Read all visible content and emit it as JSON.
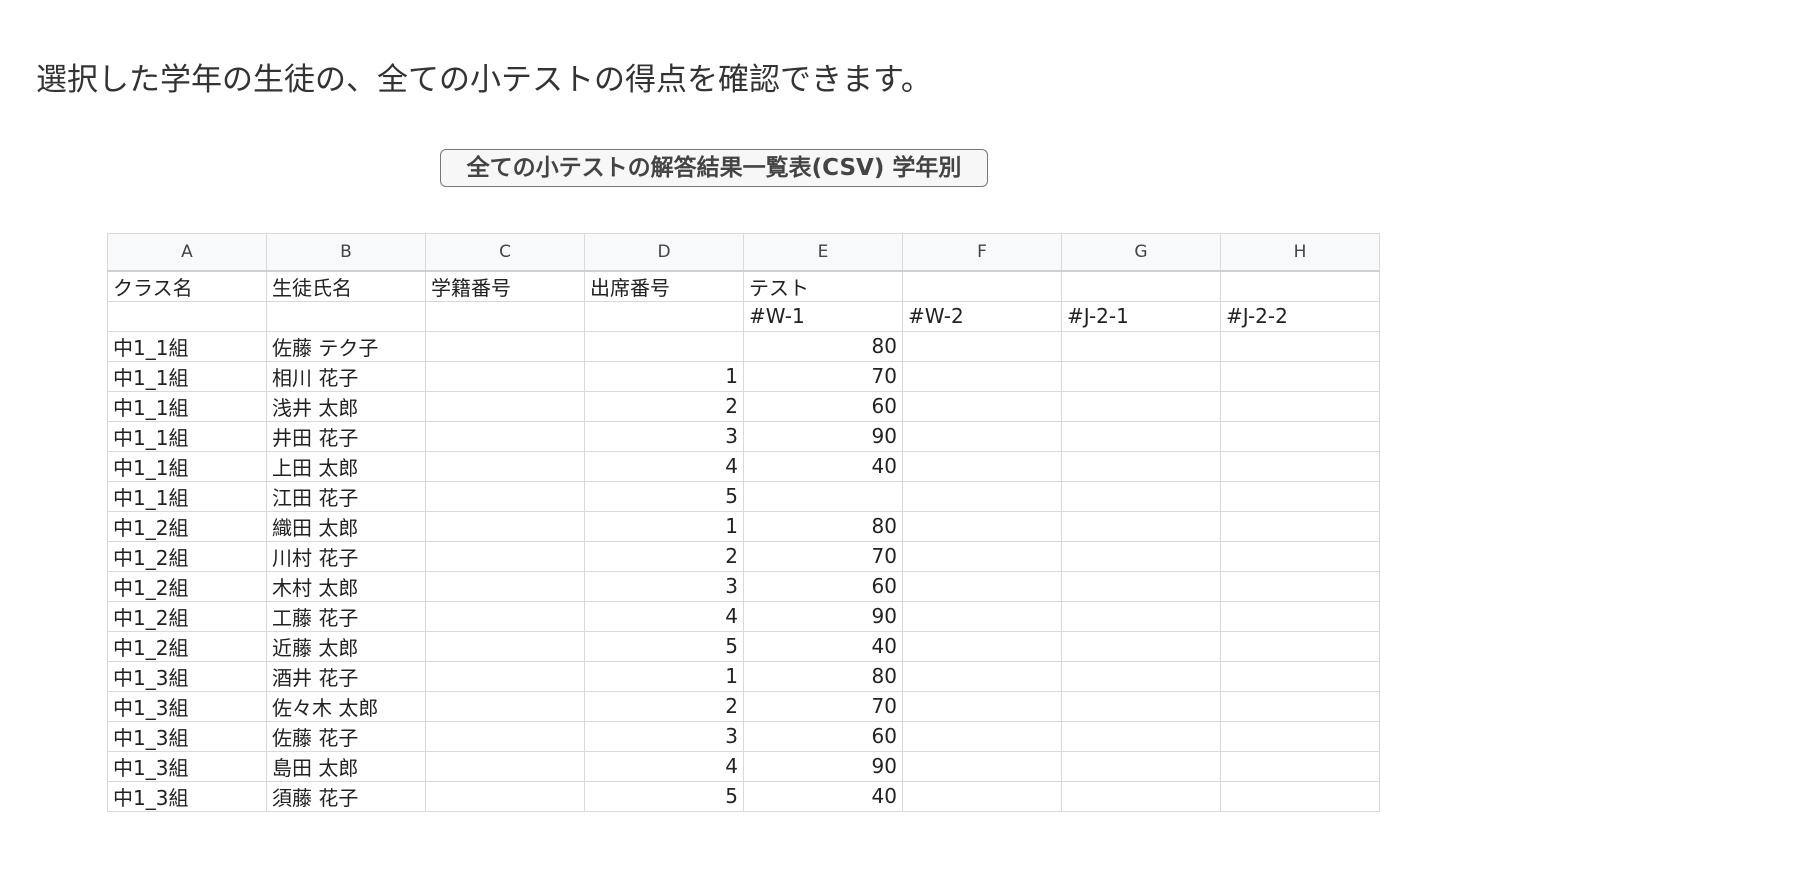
{
  "description": "選択した学年の生徒の、全ての小テストの得点を確認できます。",
  "download_button": "全ての小テストの解答結果一覧表(CSV) 学年別",
  "sheet": {
    "column_letters": [
      "A",
      "B",
      "C",
      "D",
      "E",
      "F",
      "G",
      "H"
    ],
    "header_row_1": [
      "クラス名",
      "生徒氏名",
      "学籍番号",
      "出席番号",
      "テスト",
      "",
      "",
      ""
    ],
    "header_row_2": [
      "",
      "",
      "",
      "",
      "#W-1",
      "#W-2",
      "#J-2-1",
      "#J-2-2"
    ],
    "rows": [
      [
        "中1_1組",
        "佐藤 テク子",
        "",
        "",
        "80",
        "",
        "",
        ""
      ],
      [
        "中1_1組",
        "相川 花子",
        "",
        "1",
        "70",
        "",
        "",
        ""
      ],
      [
        "中1_1組",
        "浅井 太郎",
        "",
        "2",
        "60",
        "",
        "",
        ""
      ],
      [
        "中1_1組",
        "井田 花子",
        "",
        "3",
        "90",
        "",
        "",
        ""
      ],
      [
        "中1_1組",
        "上田 太郎",
        "",
        "4",
        "40",
        "",
        "",
        ""
      ],
      [
        "中1_1組",
        "江田 花子",
        "",
        "5",
        "",
        "",
        "",
        ""
      ],
      [
        "中1_2組",
        "織田 太郎",
        "",
        "1",
        "80",
        "",
        "",
        ""
      ],
      [
        "中1_2組",
        "川村 花子",
        "",
        "2",
        "70",
        "",
        "",
        ""
      ],
      [
        "中1_2組",
        "木村 太郎",
        "",
        "3",
        "60",
        "",
        "",
        ""
      ],
      [
        "中1_2組",
        "工藤 花子",
        "",
        "4",
        "90",
        "",
        "",
        ""
      ],
      [
        "中1_2組",
        "近藤 太郎",
        "",
        "5",
        "40",
        "",
        "",
        ""
      ],
      [
        "中1_3組",
        "酒井 花子",
        "",
        "1",
        "80",
        "",
        "",
        ""
      ],
      [
        "中1_3組",
        "佐々木 太郎",
        "",
        "2",
        "70",
        "",
        "",
        ""
      ],
      [
        "中1_3組",
        "佐藤 花子",
        "",
        "3",
        "60",
        "",
        "",
        ""
      ],
      [
        "中1_3組",
        "島田 太郎",
        "",
        "4",
        "90",
        "",
        "",
        ""
      ],
      [
        "中1_3組",
        "須藤 花子",
        "",
        "5",
        "40",
        "",
        "",
        ""
      ]
    ]
  }
}
